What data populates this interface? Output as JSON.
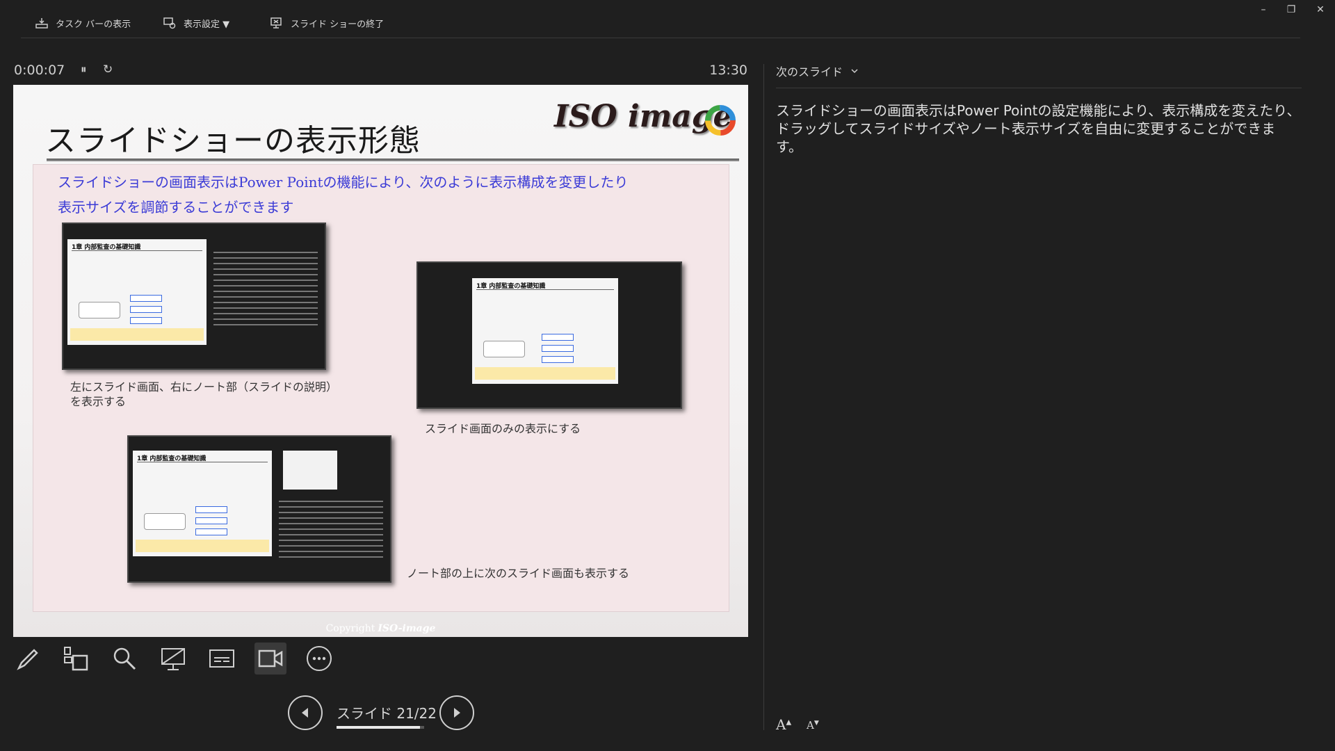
{
  "toolbar": {
    "taskbar_label": "タスク バーの表示",
    "display_settings_label": "表示設定 ▼",
    "end_show_label": "スライド ショーの終了"
  },
  "window": {
    "minimize": "–",
    "restore": "❐",
    "close": "✕"
  },
  "timer": {
    "elapsed": "0:00:07",
    "pause_icon": "⏸",
    "restart_icon": "↻",
    "clock": "13:30"
  },
  "slide": {
    "title": "スライドショーの表示形態",
    "logo_text": "ISO image",
    "lead_line1": "スライドショーの画面表示はPower Pointの機能により、次のように表示構成を変更したり",
    "lead_line2": "表示サイズを調節することができます",
    "caption1_line1": "左にスライド画面、右にノート部（スライドの説明）",
    "caption1_line2": "を表示する",
    "caption2": "スライド画面のみの表示にする",
    "caption3": "ノート部の上に次のスライド画面も表示する",
    "mini_title": "1章 内部監査の基礎知識",
    "copyright": "Copyright",
    "copyright_logo": "ISO-image"
  },
  "tools": [
    "pen-tool",
    "slide-grid",
    "zoom",
    "pointer-screen",
    "subtitles",
    "camera",
    "more-options"
  ],
  "nav": {
    "slide_counter": "スライド 21/22",
    "current": 21,
    "total": 22
  },
  "right_pane": {
    "next_slide_label": "次のスライド",
    "notes": "スライドショーの画面表示はPower Pointの設定機能により、表示構成を変えたり、ドラッグしてスライドサイズやノート表示サイズを自由に変更することができます。",
    "font_increase": "A",
    "font_decrease": "A"
  },
  "colors": {
    "background": "#1f1f1f",
    "lead_text": "#3b3bd6",
    "panel": "#f4e6e8"
  }
}
